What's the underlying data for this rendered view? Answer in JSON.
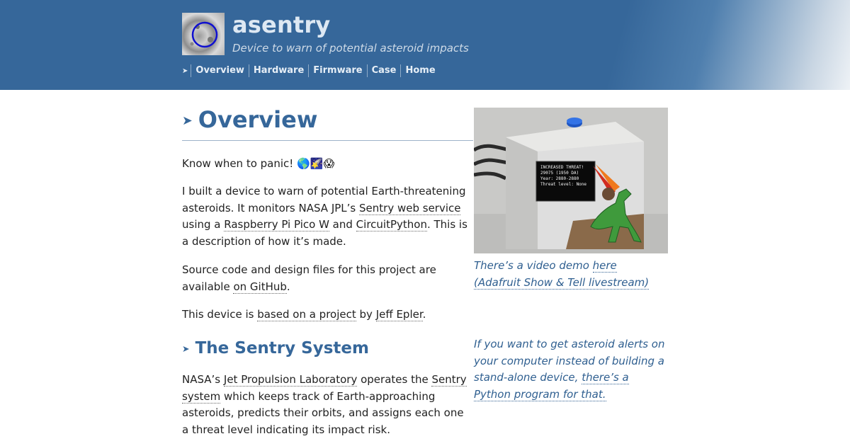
{
  "site": {
    "title": "asentry",
    "tagline": "Device to warn of potential asteroid impacts"
  },
  "nav": {
    "items": [
      "Overview",
      "Hardware",
      "Firmware",
      "Case",
      "Home"
    ]
  },
  "main": {
    "heading": "Overview",
    "intro": {
      "text": "Know when to panic!",
      "emojis": "🌎🌠😱"
    },
    "p1": {
      "t1": "I built a device to warn of potential Earth-threatening asteroids. It monitors NASA JPL’s ",
      "link1": "Sentry web service",
      "t2": " using a ",
      "link2": "Raspberry Pi Pico W",
      "t3": " and ",
      "link3": "CircuitPython",
      "t4": ". This is a description of how it’s made."
    },
    "p2": {
      "t1": "Source code and design files for this project are available ",
      "link1": "on GitHub",
      "t2": "."
    },
    "p3": {
      "t1": "This device is ",
      "link1": "based on a project",
      "t2": " by ",
      "link2": "Jeff Epler",
      "t3": "."
    },
    "section2": {
      "heading": "The Sentry System",
      "p1": {
        "t1": "NASA’s ",
        "link1": "Jet Propulsion Laboratory",
        "t2": " operates the ",
        "link2": "Sentry system",
        "t3": " which keeps track of Earth-approaching asteroids, predicts their orbits, and assigns each one a threat level indicating its impact risk."
      }
    }
  },
  "aside": {
    "photo_screen": [
      "INCREASED THREAT!",
      "29075 (1950 DA)",
      "Year: 2880-2880",
      "Threat level: None"
    ],
    "caption1": {
      "t1": "There’s a video demo ",
      "link1": "here (Adafruit Show & Tell livestream)"
    },
    "caption2": {
      "t1": "If you want to get asteroid alerts on your computer instead of building a stand-alone device, ",
      "link1": "there’s a Python program for that."
    }
  },
  "colors": {
    "header": "#36679a",
    "heading": "#36679a",
    "caption": "#2f5f90"
  }
}
